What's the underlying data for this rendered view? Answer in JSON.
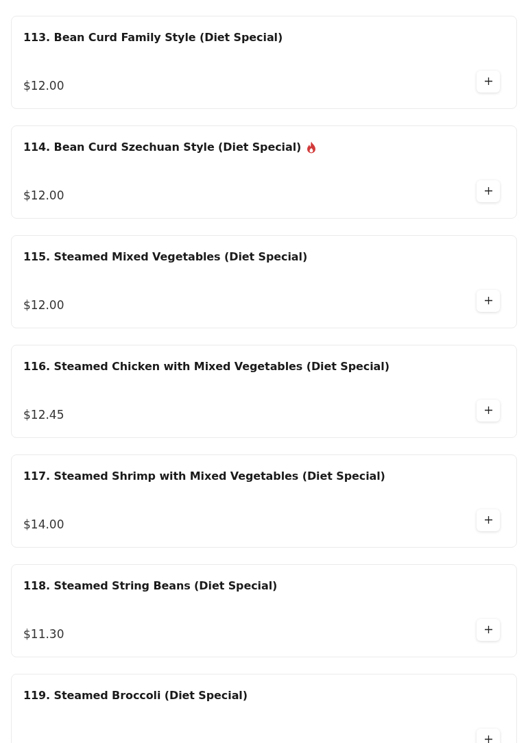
{
  "items": [
    {
      "name": "113. Bean Curd Family Style (Diet Special)",
      "spicy": false,
      "price": "$12.00"
    },
    {
      "name": "114. Bean Curd Szechuan Style (Diet Special)",
      "spicy": true,
      "price": "$12.00"
    },
    {
      "name": "115. Steamed Mixed Vegetables (Diet Special)",
      "spicy": false,
      "price": "$12.00"
    },
    {
      "name": "116. Steamed Chicken with Mixed Vegetables (Diet Special)",
      "spicy": false,
      "price": "$12.45"
    },
    {
      "name": "117. Steamed Shrimp with Mixed Vegetables (Diet Special)",
      "spicy": false,
      "price": "$14.00"
    },
    {
      "name": "118. Steamed String Beans (Diet Special)",
      "spicy": false,
      "price": "$11.30"
    },
    {
      "name": "119. Steamed Broccoli (Diet Special)",
      "spicy": false
    }
  ]
}
